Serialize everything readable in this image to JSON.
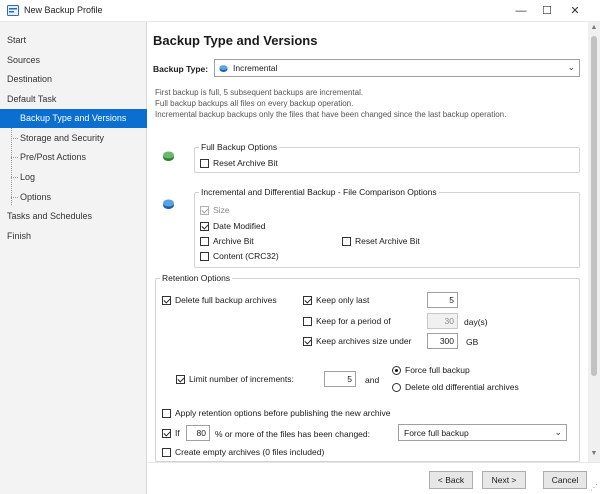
{
  "window": {
    "title": "New Backup Profile",
    "minimize": "—",
    "maximize": "☐",
    "close": "✕"
  },
  "sidebar": {
    "items": [
      {
        "label": "Start"
      },
      {
        "label": "Sources"
      },
      {
        "label": "Destination"
      },
      {
        "label": "Default Task"
      },
      {
        "label": "Backup Type and Versions"
      },
      {
        "label": "Storage and Security"
      },
      {
        "label": "Pre/Post Actions"
      },
      {
        "label": "Log"
      },
      {
        "label": "Options"
      },
      {
        "label": "Tasks and Schedules"
      },
      {
        "label": "Finish"
      }
    ],
    "active_index": 4
  },
  "main": {
    "title": "Backup Type and Versions",
    "backup_type_label": "Backup Type:",
    "backup_type_value": "Incremental",
    "description": [
      "First backup is full, 5 subsequent backups are incremental.",
      "Full backup backups all files on every backup operation.",
      "Incremental backup backups only the files that have been changed since the last backup operation."
    ],
    "full_backup_options": {
      "title": "Full Backup Options",
      "reset_archive_bit": {
        "label": "Reset Archive Bit",
        "checked": false
      }
    },
    "comparison_options": {
      "title": "Incremental and Differential Backup - File Comparison Options",
      "size": {
        "label": "Size",
        "checked": true,
        "enabled": false
      },
      "date_modified": {
        "label": "Date Modified",
        "checked": true
      },
      "archive_bit": {
        "label": "Archive Bit",
        "checked": false
      },
      "reset_archive_bit": {
        "label": "Reset Archive Bit",
        "checked": false
      },
      "content": {
        "label": "Content (CRC32)",
        "checked": false
      }
    },
    "retention": {
      "title": "Retention Options",
      "delete_full": {
        "label": "Delete full backup archives",
        "checked": true
      },
      "keep_only_last": {
        "label": "Keep only last",
        "checked": true,
        "value": "5"
      },
      "keep_period": {
        "label": "Keep for a period of",
        "checked": false,
        "value": "30",
        "unit": "day(s)"
      },
      "keep_size": {
        "label": "Keep archives size under",
        "checked": true,
        "value": "300",
        "unit": "GB"
      },
      "limit_increments": {
        "label": "Limit number of increments:",
        "checked": true,
        "value": "5",
        "and": "and"
      },
      "force_full": {
        "label": "Force full backup",
        "selected": true
      },
      "delete_old_diff": {
        "label": "Delete old differential archives",
        "selected": false
      },
      "apply_before": {
        "label": "Apply retention options before publishing the new archive",
        "checked": false
      },
      "if_changed": {
        "prefix": "If",
        "checked": true,
        "value": "80",
        "suffix": "% or more of the files has been changed:",
        "action": "Force full backup"
      },
      "create_empty": {
        "label": "Create empty archives (0 files included)",
        "checked": false
      }
    }
  },
  "footer": {
    "back": "< Back",
    "next": "Next >",
    "cancel": "Cancel"
  },
  "colors": {
    "accent": "#0a6fd1",
    "sidebar_bg": "#f3f3f3"
  },
  "icons": {
    "app": "backup-app-icon",
    "backup_type": "incremental-icon",
    "full_options": "full-backup-icon",
    "comparison": "incremental-backup-icon"
  }
}
